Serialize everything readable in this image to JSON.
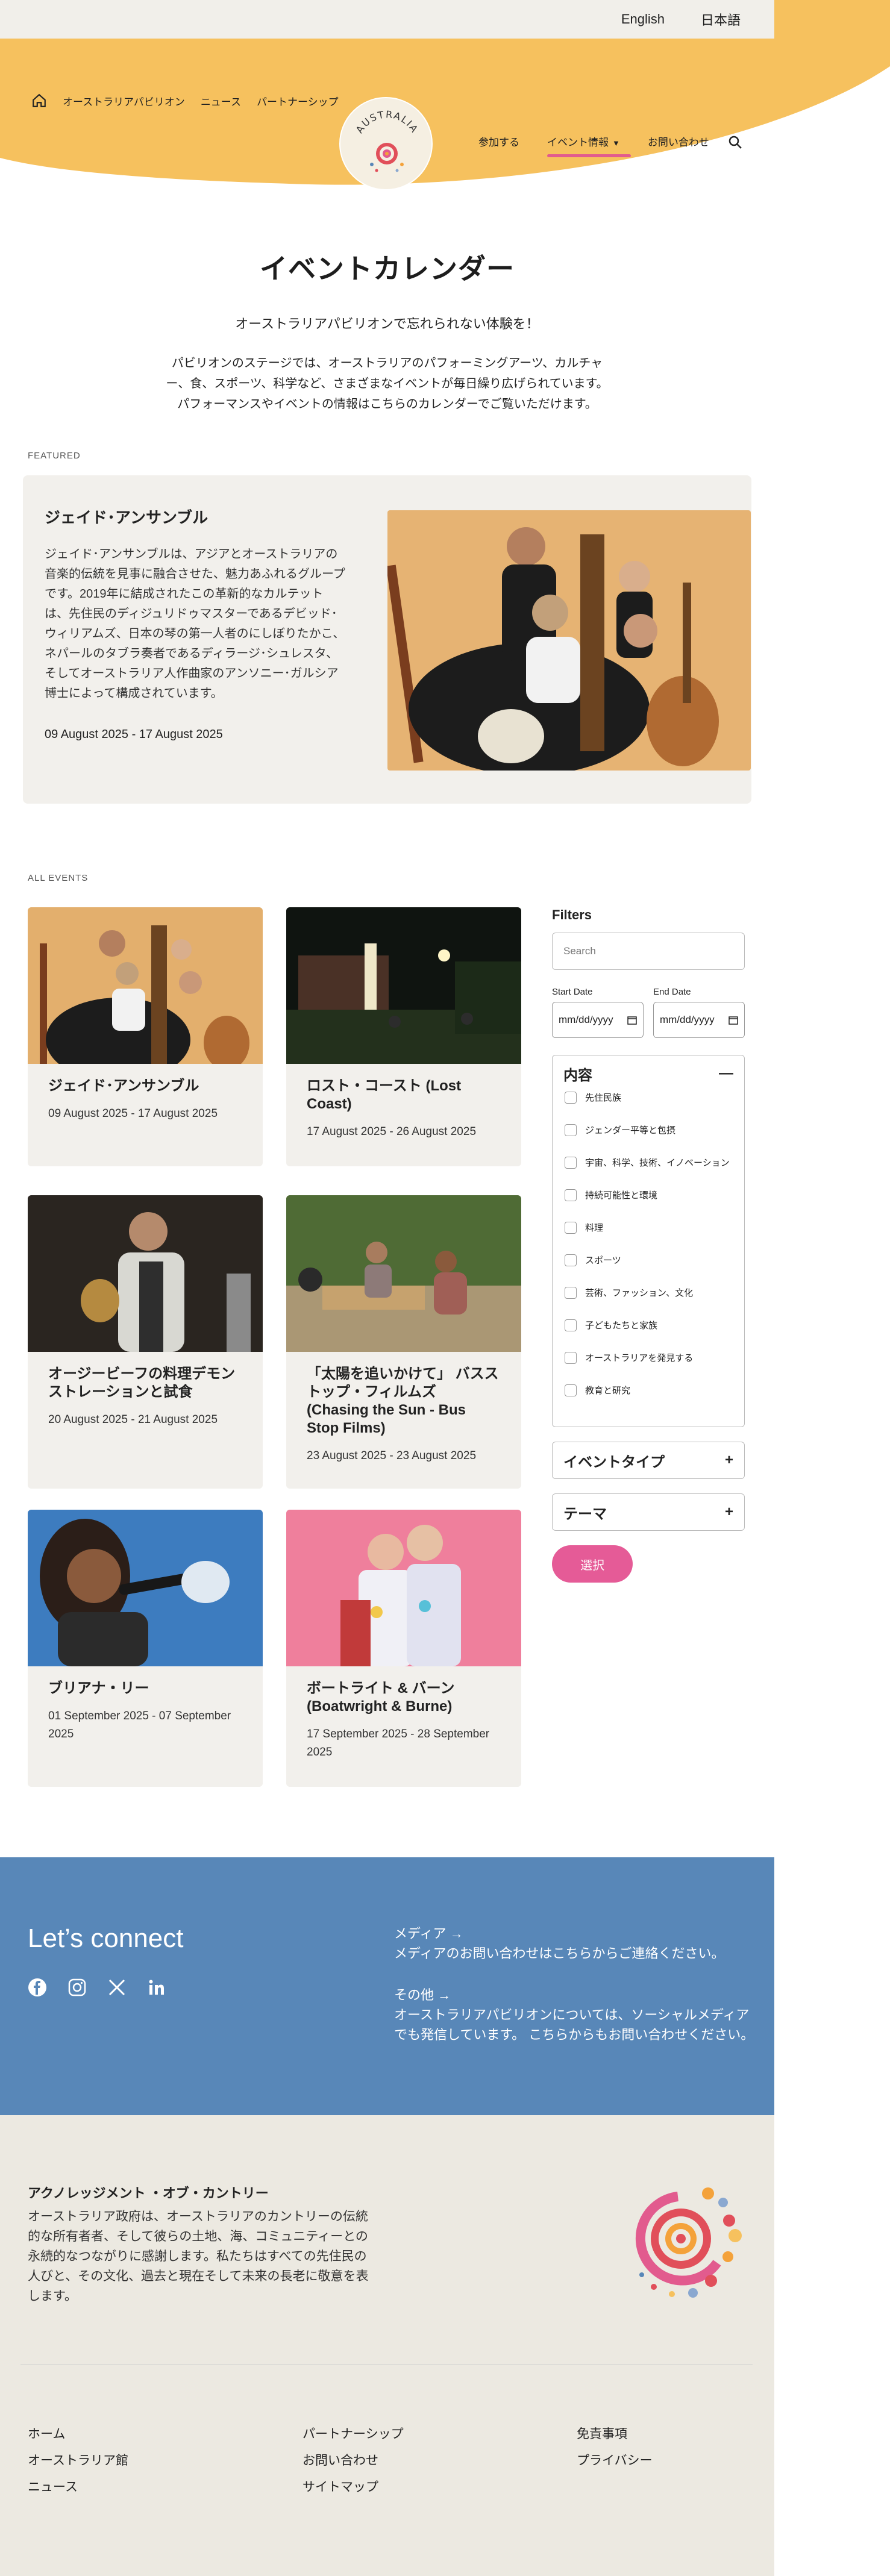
{
  "lang": {
    "english": "English",
    "japanese": "日本語"
  },
  "nav": {
    "left": [
      "オーストラリアパビリオン",
      "ニュース",
      "パートナーシップ"
    ],
    "right": [
      "参加する",
      "イベント情報",
      "お問い合わせ"
    ],
    "logo_text": "AUSTRALIA"
  },
  "intro": {
    "title": "イベントカレンダー",
    "lead": "オーストラリアパビリオンで忘れられない体験を！",
    "desc": "パビリオンのステージでは、オーストラリアのパフォーミングアーツ、カルチャー、食、スポーツ、科学など、さまざまなイベントが毎日繰り広げられています。パフォーマンスやイベントの情報はこちらのカレンダーでご覧いただけます。"
  },
  "featured": {
    "label": "FEATURED",
    "title": "ジェイド･アンサンブル",
    "desc": "ジェイド･アンサンブルは、アジアとオーストラリアの音楽的伝統を見事に融合させた、魅力あふれるグループです。2019年に結成されたこの革新的なカルテットは、先住民のディジュリドゥマスターであるデビッド･ウィリアムズ、日本の琴の第一人者のにしぼりたかこ、ネパールのタブラ奏者であるディラージ･シュレスタ、そしてオーストラリア人作曲家のアンソニー･ガルシア博士によって構成されています。",
    "date": "09 August 2025 - 17 August 2025"
  },
  "all_events_label": "ALL EVENTS",
  "events": [
    {
      "title": "ジェイド･アンサンブル",
      "date": "09 August 2025 - 17 August 2025"
    },
    {
      "title": "ロスト・コースト (Lost Coast)",
      "date": "17 August 2025 - 26 August 2025"
    },
    {
      "title": "オージービーフの料理デモンストレーションと試食",
      "date": "20 August 2025 - 21 August 2025"
    },
    {
      "title": "「太陽を追いかけて」 バスストップ・フィルムズ (Chasing the Sun - Bus Stop Films)",
      "date": "23 August 2025 - 23 August 2025"
    },
    {
      "title": "ブリアナ・リー",
      "date": "01 September 2025 - 07 September 2025"
    },
    {
      "title": "ボートライト & バーン (Boatwright & Burne)",
      "date": "17 September 2025 - 28 September 2025"
    }
  ],
  "filters": {
    "title": "Filters",
    "search_placeholder": "Search",
    "start_label": "Start Date",
    "end_label": "End Date",
    "date_placeholder": "mm/dd/yyyy",
    "content_title": "内容",
    "content_options": [
      "先住民族",
      "ジェンダー平等と包摂",
      "宇宙、科学、技術、イノベーション",
      "持続可能性と環境",
      "料理",
      "スポーツ",
      "芸術、ファッション、文化",
      "子どもたちと家族",
      "オーストラリアを発見する",
      "教育と研究"
    ],
    "type_title": "イベントタイプ",
    "theme_title": "テーマ",
    "select_label": "選択"
  },
  "connect": {
    "title": "Let’s connect",
    "media_title": "メディア →",
    "media_text": "メディアのお問い合わせはこちらからご連絡ください。",
    "other_title": "その他 →",
    "other_text": "オーストラリアパビリオンについては、ソーシャルメディアでも発信しています。 こちらからもお問い合わせください。"
  },
  "ack": {
    "title": "アクノレッジメント ・オブ・カントリー",
    "text": "オーストラリア政府は、オーストラリアのカントリーの伝統的な所有者者、そして彼らの土地、海、コミュニティーとの永続的なつながりに感謝します。私たちはすべての先住民の人びと、その文化、過去と現在そして未来の長老に敬意を表します。"
  },
  "footer": {
    "col1": [
      "ホーム",
      "オーストラリア館",
      "ニュース"
    ],
    "col2": [
      "パートナーシップ",
      "お問い合わせ",
      "サイトマップ"
    ],
    "col3": [
      "免責事項",
      "プライバシー"
    ]
  },
  "colors": {
    "yellow": "#f6c15e",
    "pink": "#e55b97",
    "blue": "#5887b8",
    "beige": "#ece9e1",
    "card": "#f2f0ec"
  }
}
